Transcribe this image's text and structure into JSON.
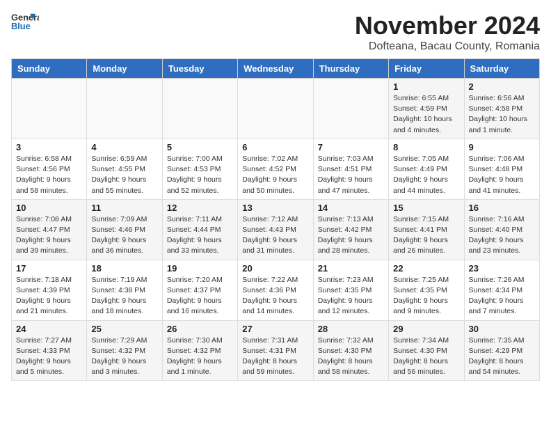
{
  "header": {
    "logo_general": "General",
    "logo_blue": "Blue",
    "month_title": "November 2024",
    "subtitle": "Dofteana, Bacau County, Romania"
  },
  "days_of_week": [
    "Sunday",
    "Monday",
    "Tuesday",
    "Wednesday",
    "Thursday",
    "Friday",
    "Saturday"
  ],
  "weeks": [
    [
      {
        "day": "",
        "info": ""
      },
      {
        "day": "",
        "info": ""
      },
      {
        "day": "",
        "info": ""
      },
      {
        "day": "",
        "info": ""
      },
      {
        "day": "",
        "info": ""
      },
      {
        "day": "1",
        "info": "Sunrise: 6:55 AM\nSunset: 4:59 PM\nDaylight: 10 hours and 4 minutes."
      },
      {
        "day": "2",
        "info": "Sunrise: 6:56 AM\nSunset: 4:58 PM\nDaylight: 10 hours and 1 minute."
      }
    ],
    [
      {
        "day": "3",
        "info": "Sunrise: 6:58 AM\nSunset: 4:56 PM\nDaylight: 9 hours and 58 minutes."
      },
      {
        "day": "4",
        "info": "Sunrise: 6:59 AM\nSunset: 4:55 PM\nDaylight: 9 hours and 55 minutes."
      },
      {
        "day": "5",
        "info": "Sunrise: 7:00 AM\nSunset: 4:53 PM\nDaylight: 9 hours and 52 minutes."
      },
      {
        "day": "6",
        "info": "Sunrise: 7:02 AM\nSunset: 4:52 PM\nDaylight: 9 hours and 50 minutes."
      },
      {
        "day": "7",
        "info": "Sunrise: 7:03 AM\nSunset: 4:51 PM\nDaylight: 9 hours and 47 minutes."
      },
      {
        "day": "8",
        "info": "Sunrise: 7:05 AM\nSunset: 4:49 PM\nDaylight: 9 hours and 44 minutes."
      },
      {
        "day": "9",
        "info": "Sunrise: 7:06 AM\nSunset: 4:48 PM\nDaylight: 9 hours and 41 minutes."
      }
    ],
    [
      {
        "day": "10",
        "info": "Sunrise: 7:08 AM\nSunset: 4:47 PM\nDaylight: 9 hours and 39 minutes."
      },
      {
        "day": "11",
        "info": "Sunrise: 7:09 AM\nSunset: 4:46 PM\nDaylight: 9 hours and 36 minutes."
      },
      {
        "day": "12",
        "info": "Sunrise: 7:11 AM\nSunset: 4:44 PM\nDaylight: 9 hours and 33 minutes."
      },
      {
        "day": "13",
        "info": "Sunrise: 7:12 AM\nSunset: 4:43 PM\nDaylight: 9 hours and 31 minutes."
      },
      {
        "day": "14",
        "info": "Sunrise: 7:13 AM\nSunset: 4:42 PM\nDaylight: 9 hours and 28 minutes."
      },
      {
        "day": "15",
        "info": "Sunrise: 7:15 AM\nSunset: 4:41 PM\nDaylight: 9 hours and 26 minutes."
      },
      {
        "day": "16",
        "info": "Sunrise: 7:16 AM\nSunset: 4:40 PM\nDaylight: 9 hours and 23 minutes."
      }
    ],
    [
      {
        "day": "17",
        "info": "Sunrise: 7:18 AM\nSunset: 4:39 PM\nDaylight: 9 hours and 21 minutes."
      },
      {
        "day": "18",
        "info": "Sunrise: 7:19 AM\nSunset: 4:38 PM\nDaylight: 9 hours and 18 minutes."
      },
      {
        "day": "19",
        "info": "Sunrise: 7:20 AM\nSunset: 4:37 PM\nDaylight: 9 hours and 16 minutes."
      },
      {
        "day": "20",
        "info": "Sunrise: 7:22 AM\nSunset: 4:36 PM\nDaylight: 9 hours and 14 minutes."
      },
      {
        "day": "21",
        "info": "Sunrise: 7:23 AM\nSunset: 4:35 PM\nDaylight: 9 hours and 12 minutes."
      },
      {
        "day": "22",
        "info": "Sunrise: 7:25 AM\nSunset: 4:35 PM\nDaylight: 9 hours and 9 minutes."
      },
      {
        "day": "23",
        "info": "Sunrise: 7:26 AM\nSunset: 4:34 PM\nDaylight: 9 hours and 7 minutes."
      }
    ],
    [
      {
        "day": "24",
        "info": "Sunrise: 7:27 AM\nSunset: 4:33 PM\nDaylight: 9 hours and 5 minutes."
      },
      {
        "day": "25",
        "info": "Sunrise: 7:29 AM\nSunset: 4:32 PM\nDaylight: 9 hours and 3 minutes."
      },
      {
        "day": "26",
        "info": "Sunrise: 7:30 AM\nSunset: 4:32 PM\nDaylight: 9 hours and 1 minute."
      },
      {
        "day": "27",
        "info": "Sunrise: 7:31 AM\nSunset: 4:31 PM\nDaylight: 8 hours and 59 minutes."
      },
      {
        "day": "28",
        "info": "Sunrise: 7:32 AM\nSunset: 4:30 PM\nDaylight: 8 hours and 58 minutes."
      },
      {
        "day": "29",
        "info": "Sunrise: 7:34 AM\nSunset: 4:30 PM\nDaylight: 8 hours and 56 minutes."
      },
      {
        "day": "30",
        "info": "Sunrise: 7:35 AM\nSunset: 4:29 PM\nDaylight: 8 hours and 54 minutes."
      }
    ]
  ]
}
